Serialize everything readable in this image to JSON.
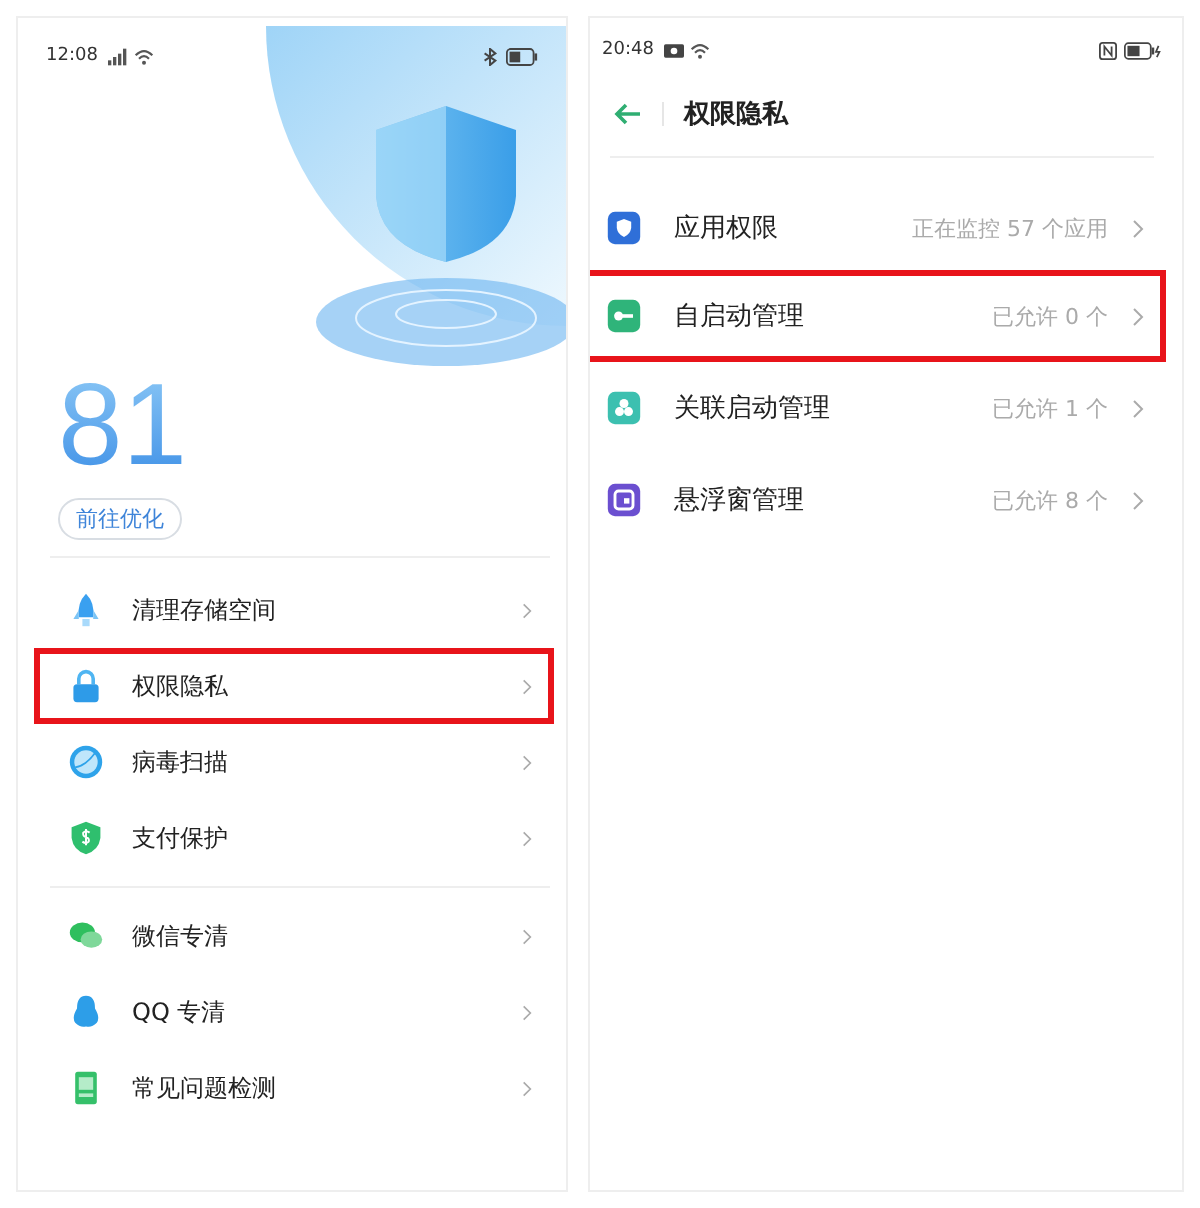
{
  "left_screen": {
    "status_bar": {
      "time": "12:08"
    },
    "score": "81",
    "optimize_button": "前往优化",
    "items": [
      {
        "kind": "rocket",
        "label": "清理存储空间",
        "highlighted": false
      },
      {
        "kind": "lock",
        "label": "权限隐私",
        "highlighted": true
      },
      {
        "kind": "scan",
        "label": "病毒扫描",
        "highlighted": false
      },
      {
        "kind": "pay",
        "label": "支付保护",
        "highlighted": false
      },
      {
        "kind": "chat",
        "label": "微信专清",
        "highlighted": false,
        "group_start": true
      },
      {
        "kind": "penguin",
        "label": "QQ 专清",
        "highlighted": false
      },
      {
        "kind": "check",
        "label": "常见问题检测",
        "highlighted": false
      }
    ]
  },
  "right_screen": {
    "status_bar": {
      "time": "20:48"
    },
    "title": "权限隐私",
    "items": [
      {
        "kind": "shield",
        "label": "应用权限",
        "status": "正在监控 57 个应用",
        "highlighted": false
      },
      {
        "kind": "key",
        "label": "自启动管理",
        "status": "已允许 0 个",
        "highlighted": true
      },
      {
        "kind": "cluster",
        "label": "关联启动管理",
        "status": "已允许 1 个",
        "highlighted": false
      },
      {
        "kind": "float",
        "label": "悬浮窗管理",
        "status": "已允许 8 个",
        "highlighted": false
      }
    ]
  }
}
